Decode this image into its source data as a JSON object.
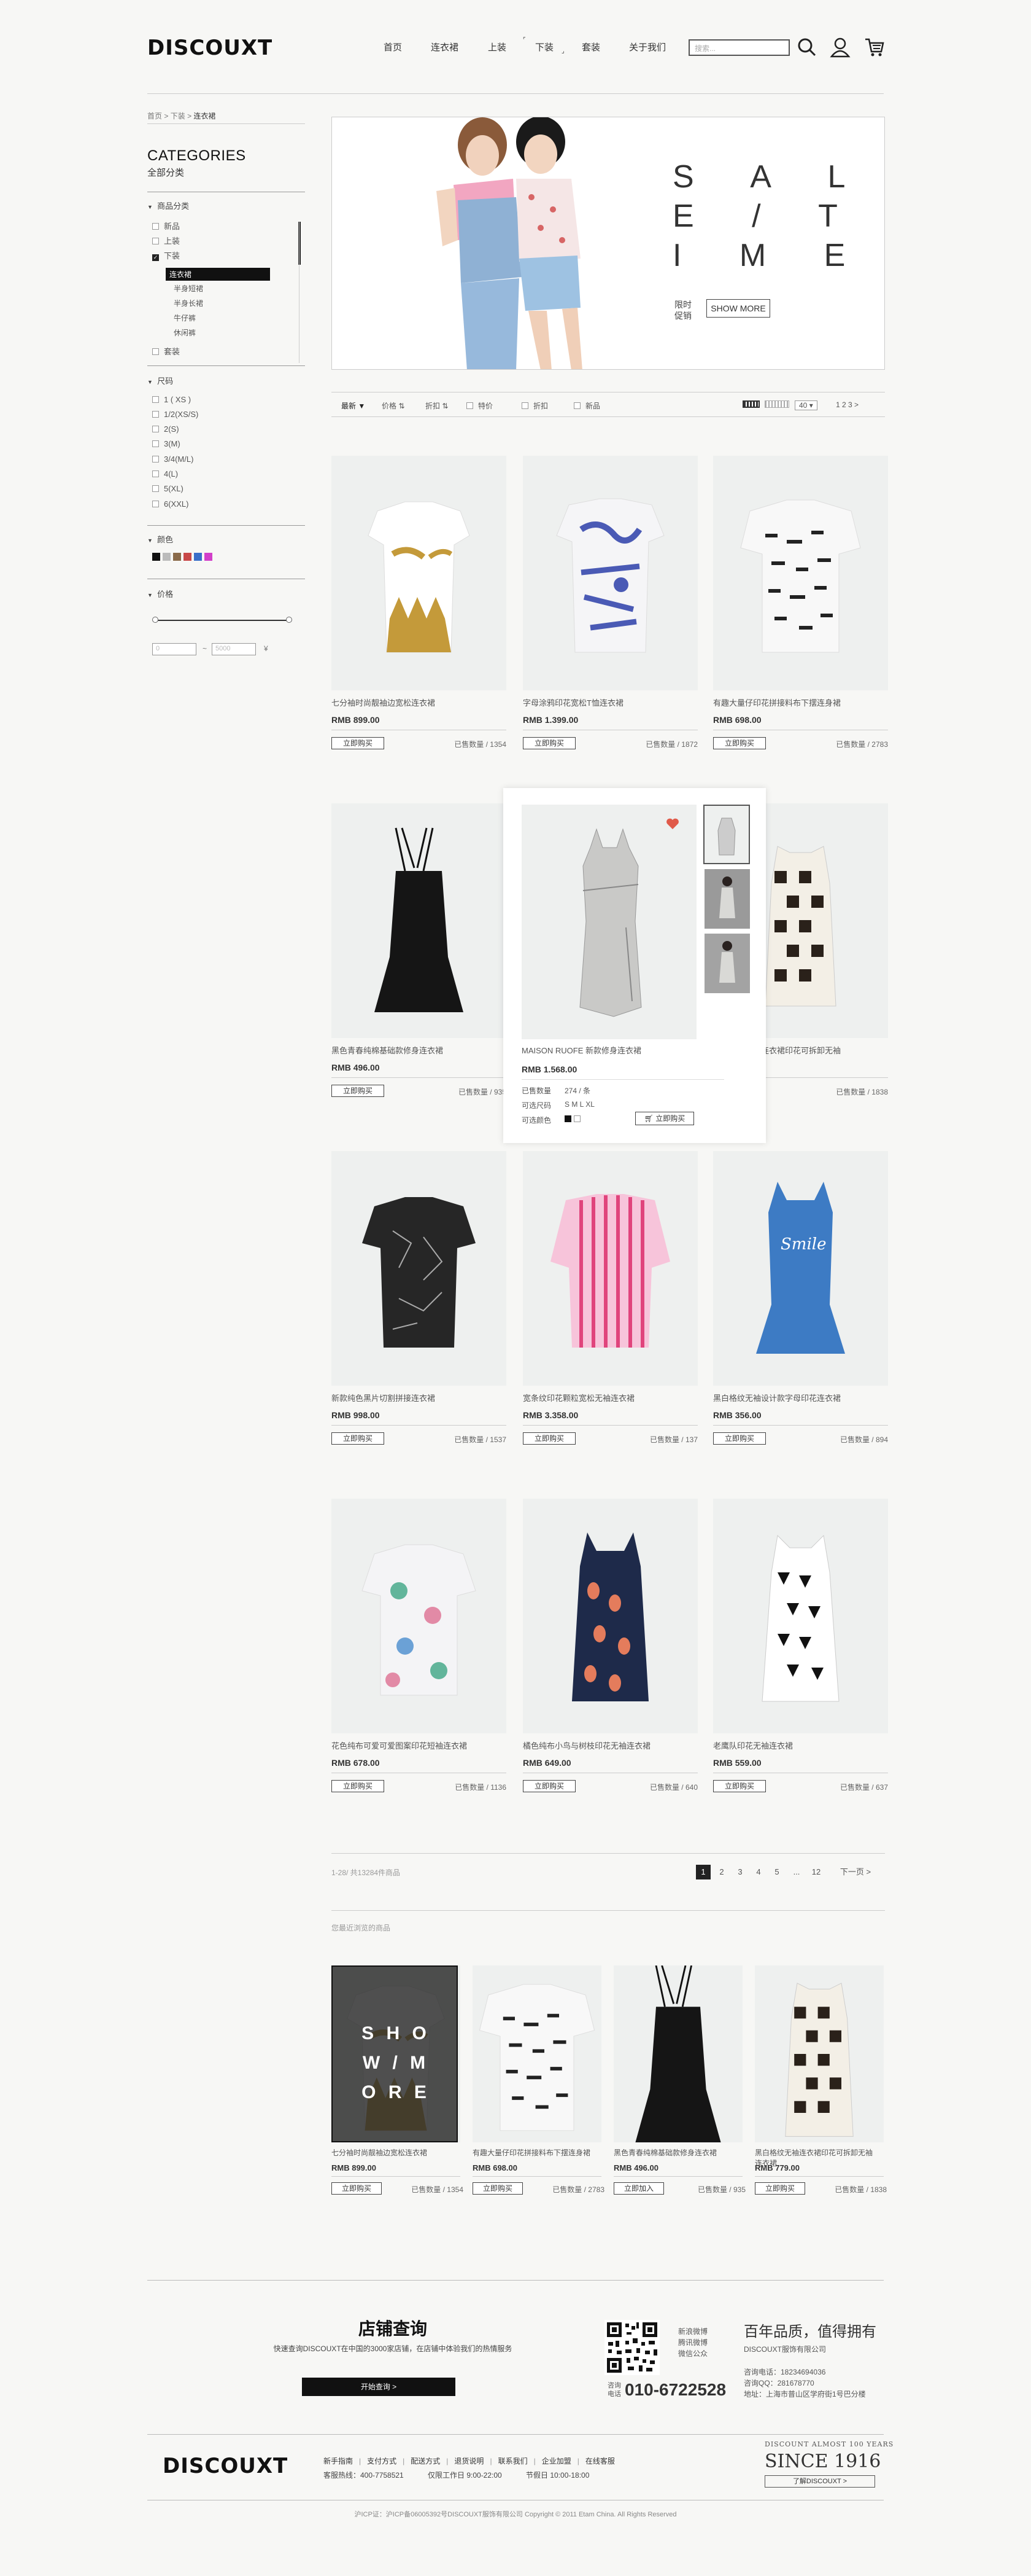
{
  "header": {
    "logo": "DISCOUXT",
    "nav": [
      "首页",
      "连衣裙",
      "上装",
      "下装",
      "套装",
      "关于我们"
    ],
    "search_placeholder": "搜索..."
  },
  "breadcrumb": {
    "items": [
      "首页",
      "下装"
    ],
    "current": "连衣裙",
    "sep": " > "
  },
  "sidebar": {
    "title": "CATEGORIES",
    "subtitle": "全部分类",
    "category_heading": "商品分类",
    "categories": [
      "新品",
      "上装",
      "下装"
    ],
    "subcategories": [
      "连衣裙",
      "半身短裙",
      "半身长裙",
      "牛仔裤",
      "休闲裤"
    ],
    "last_category": "套装",
    "size_heading": "尺码",
    "sizes": [
      "1 ( XS )",
      "1/2(XS/S)",
      "2(S)",
      "3(M)",
      "3/4(M/L)",
      "4(L)",
      "5(XL)",
      "6(XXL)"
    ],
    "color_heading": "颜色",
    "colors": [
      "#111111",
      "#bbbbbb",
      "#8a6a4a",
      "#c84848",
      "#3a6fc9",
      "#d23fc9"
    ],
    "price_heading": "价格",
    "price_min": "0",
    "price_to": "~",
    "price_max": "5000",
    "price_unit": "¥"
  },
  "banner": {
    "line1": "S A L",
    "line2": "E / T",
    "line3": "I M E",
    "tag1": "限时",
    "tag2": "促销",
    "button": "SHOW MORE"
  },
  "toolbar": {
    "sort": [
      "最新",
      "价格",
      "折扣",
      "特价",
      "新品"
    ],
    "checks": [
      "特价",
      "新品"
    ],
    "sort_dropdown": [
      "最新",
      "价格",
      "折扣"
    ],
    "per_page": "40",
    "pages": "1  2  3"
  },
  "products": [
    {
      "name": "七分袖时尚靓袖边宽松连衣裙",
      "price": "RMB 899.00",
      "btn": "立即购买",
      "sold": "已售数量 / 1354"
    },
    {
      "name": "字母涂鸦印花宽松T恤连衣裙",
      "price": "RMB 1.399.00",
      "btn": "立即购买",
      "sold": "已售数量 / 1872"
    },
    {
      "name": "有趣大量仔印花拼接料布下摆连身裙",
      "price": "RMB 698.00",
      "btn": "立即购买",
      "sold": "已售数量 / 2783"
    },
    {
      "name": "黑色青春纯棉基础款修身连衣裙",
      "price": "RMB 496.00",
      "btn": "立即购买",
      "sold": "已售数量 / 935"
    },
    {
      "name": "MAISON RUOFE 新款修身连衣裙",
      "price": "RMB 1.568.00",
      "btn": "立即购买",
      "sold": ""
    },
    {
      "name": "黑白格纹无袖连衣裙印花可拆卸无袖",
      "price": "RMB 779.00",
      "btn": "立即购买",
      "sold": "已售数量 / 1838"
    },
    {
      "name": "新款纯色黑片切割拼接连衣裙",
      "price": "RMB 998.00",
      "btn": "立即购买",
      "sold": "已售数量 / 1537"
    },
    {
      "name": "宽条纹印花颗粒宽松无袖连衣裙",
      "price": "RMB 3.358.00",
      "btn": "立即购买",
      "sold": "已售数量 / 137"
    },
    {
      "name": "黑白格纹无袖设计款字母印花连衣裙",
      "price": "RMB 356.00",
      "btn": "立即购买",
      "sold": "已售数量 / 894"
    },
    {
      "name": "花色纯布可爱可爱图案印花短袖连衣裙",
      "price": "RMB 678.00",
      "btn": "立即购买",
      "sold": "已售数量 / 1136"
    },
    {
      "name": "橘色纯布小鸟与树枝印花无袖连衣裙",
      "price": "RMB 649.00",
      "btn": "立即购买",
      "sold": "已售数量 / 640"
    },
    {
      "name": "老鹰队印花无袖连衣裙",
      "price": "RMB 559.00",
      "btn": "立即购买",
      "sold": "已售数量 / 637"
    }
  ],
  "hover": {
    "sold_label": "已售数量",
    "sold_val": "274 / 条",
    "size_label": "可选尺码",
    "sizes": "S  M  L  XL",
    "color_label": "可选颜色",
    "buy": "立即购买"
  },
  "pagination": {
    "summary": "1-28/ 共13284件商品",
    "pages": [
      "1",
      "2",
      "3",
      "4",
      "5",
      "...",
      "12"
    ],
    "next": "下一页 >"
  },
  "recent": {
    "title": "您最近浏览的商品",
    "show_more": [
      "S H O",
      "W / M",
      "O R E"
    ],
    "items": [
      {
        "name": "七分袖时尚靓袖边宽松连衣裙",
        "price": "RMB 899.00",
        "btn": "立即购买",
        "sold": "已售数量 / 1354"
      },
      {
        "name": "有趣大量仔印花拼接料布下摆连身裙",
        "price": "RMB 698.00",
        "btn": "立即购买",
        "sold": "已售数量 / 2783"
      },
      {
        "name": "黑色青春纯棉基础款修身连衣裙",
        "price": "RMB 496.00",
        "btn": "立即加入",
        "sold": "已售数量 / 935"
      },
      {
        "name": "黑白格纹无袖连衣裙印花可拆卸无袖连衣裙",
        "price": "RMB 779.00",
        "btn": "立即购买",
        "sold": "已售数量 / 1838"
      }
    ]
  },
  "footer": {
    "store_title": "店铺查询",
    "store_desc": "快速查询DISCOUXT在中国的3000家店铺，在店铺中体验我们的热情服务",
    "store_btn": "开始查询 >",
    "qr_links": [
      "新浪微博",
      "腾讯微博",
      "微信公众"
    ],
    "phone_label1": "咨询",
    "phone_label2": "电话",
    "phone": "010-6722528",
    "slogan": "百年品质，值得拥有",
    "company": "DISCOUXT服饰有限公司",
    "contact": [
      "咨询电话：18234694036",
      "咨询QQ：281678770",
      "地址：上海市普山区学府街1号巴分楼"
    ],
    "logo": "DISCOUXT",
    "links": [
      "新手指南",
      "支付方式",
      "配送方式",
      "退货说明",
      "联系我们",
      "企业加盟",
      "在线客服"
    ],
    "hotline": "客服热线：400-7758521",
    "hours1": "仅限工作日 9:00-22:00",
    "hours2": "节假日 10:00-18:00",
    "brand_line": "DISCOUNT ALMOST 100 YEARS",
    "since": "SINCE 1916",
    "know_btn": "了解DISCOUXT >",
    "copyright": "沪ICP证：沪ICP备06005392号DISCOUXT服饰有限公司 Copyright © 2011 Etam China. All Rights Reserved"
  }
}
